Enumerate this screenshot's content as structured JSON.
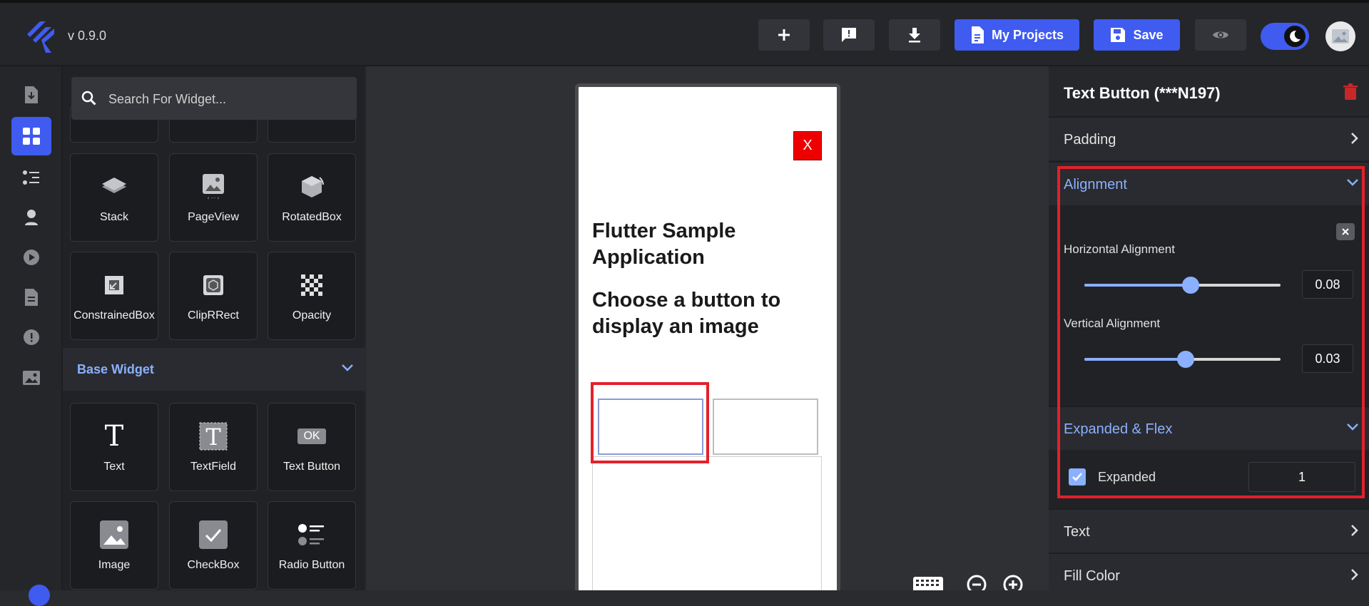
{
  "header": {
    "version": "v 0.9.0",
    "my_projects_label": "My Projects",
    "save_label": "Save"
  },
  "sidebar": {
    "search_placeholder": "Search For Widget...",
    "widgets_layout": [
      {
        "label": "Stack",
        "icon": "stack-icon"
      },
      {
        "label": "PageView",
        "icon": "pageview-icon"
      },
      {
        "label": "RotatedBox",
        "icon": "rotatedbox-icon"
      },
      {
        "label": "ConstrainedBox",
        "icon": "constrainedbox-icon"
      },
      {
        "label": "ClipRRect",
        "icon": "cliprrect-icon"
      },
      {
        "label": "Opacity",
        "icon": "opacity-icon"
      }
    ],
    "base_section_label": "Base Widget",
    "widgets_base": [
      {
        "label": "Text",
        "icon": "text-icon"
      },
      {
        "label": "TextField",
        "icon": "textfield-icon"
      },
      {
        "label": "Text Button",
        "icon": "text-button-icon",
        "badge": "OK"
      },
      {
        "label": "Image",
        "icon": "image-icon"
      },
      {
        "label": "CheckBox",
        "icon": "checkbox-icon"
      },
      {
        "label": "Radio Button",
        "icon": "radio-button-icon"
      }
    ]
  },
  "preview": {
    "close_label": "X",
    "title": "Flutter Sample Application",
    "subtitle": "Choose a button to display an image"
  },
  "properties": {
    "title": "Text Button (***N197)",
    "padding_label": "Padding",
    "alignment_label": "Alignment",
    "horizontal_label": "Horizontal Alignment",
    "horizontal_value": "0.08",
    "horizontal_fraction": 0.54,
    "vertical_label": "Vertical Alignment",
    "vertical_value": "0.03",
    "vertical_fraction": 0.515,
    "expanded_flex_label": "Expanded & Flex",
    "expanded_label": "Expanded",
    "expanded_checked": true,
    "flex_value": "1",
    "text_label": "Text",
    "fill_color_label": "Fill Color"
  },
  "colors": {
    "accent": "#3f5bf0",
    "link": "#8ab0ff",
    "highlight": "#e3202b"
  }
}
